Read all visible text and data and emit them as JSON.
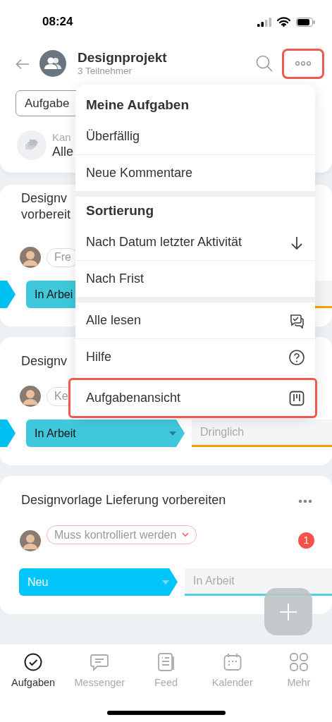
{
  "status_bar": {
    "time": "08:24"
  },
  "header": {
    "title": "Designprojekt",
    "subtitle": "3 Teilnehmer",
    "more_highlighted": true
  },
  "filter": {
    "label": "Aufgabe"
  },
  "kanban": {
    "label": "Kan",
    "value": "Alle"
  },
  "cards": [
    {
      "title_lines": [
        "Designv",
        "vorbereit"
      ],
      "tag": {
        "label": "Fre",
        "kind": "neutral"
      },
      "stages": [
        {
          "kind": "previous",
          "color": "#00c0f2"
        },
        {
          "kind": "current",
          "label": "In Arbei",
          "color": "#3fc8dc"
        },
        {
          "kind": "next",
          "color": "#f5a300"
        }
      ]
    },
    {
      "title_lines": [
        "Designv"
      ],
      "tag": {
        "label": "Ke",
        "kind": "neutral"
      },
      "stages": [
        {
          "kind": "previous",
          "color": "#00c0f2"
        },
        {
          "kind": "current",
          "label": "In Arbeit",
          "color": "#3fc8dc",
          "caret": true
        },
        {
          "kind": "next",
          "label": "Dringlich",
          "color": "#f5a300"
        }
      ]
    },
    {
      "title_lines": [
        "Designvorlage Lieferung vorbereiten"
      ],
      "more": true,
      "tag": {
        "label": "Muss kontrolliert werden",
        "kind": "alert"
      },
      "badge": "1",
      "stages": [
        {
          "kind": "current",
          "label": "Neu",
          "color": "#00c5f8",
          "caret": true
        },
        {
          "kind": "next",
          "label": "In Arbeit",
          "color": "#4fd0e0"
        }
      ]
    }
  ],
  "menu": {
    "sections": [
      {
        "heading": "Meine Aufgaben",
        "items": [
          {
            "label": "Überfällig"
          },
          {
            "label": "Neue Kommentare"
          }
        ]
      },
      {
        "heading": "Sortierung",
        "items": [
          {
            "label": "Nach Datum letzter Aktivität",
            "kind": "sort"
          },
          {
            "label": "Nach Frist"
          }
        ]
      },
      {
        "items": [
          {
            "label": "Alle lesen",
            "kind": "read"
          },
          {
            "label": "Hilfe",
            "kind": "help"
          },
          {
            "label": "Aufgabenansicht",
            "kind": "view",
            "highlighted": true
          }
        ]
      }
    ]
  },
  "tabs": [
    {
      "label": "Aufgaben",
      "selected": true
    },
    {
      "label": "Messenger",
      "selected": false
    },
    {
      "label": "Feed",
      "selected": false
    },
    {
      "label": "Kalender",
      "selected": false
    },
    {
      "label": "Mehr",
      "selected": false
    }
  ]
}
